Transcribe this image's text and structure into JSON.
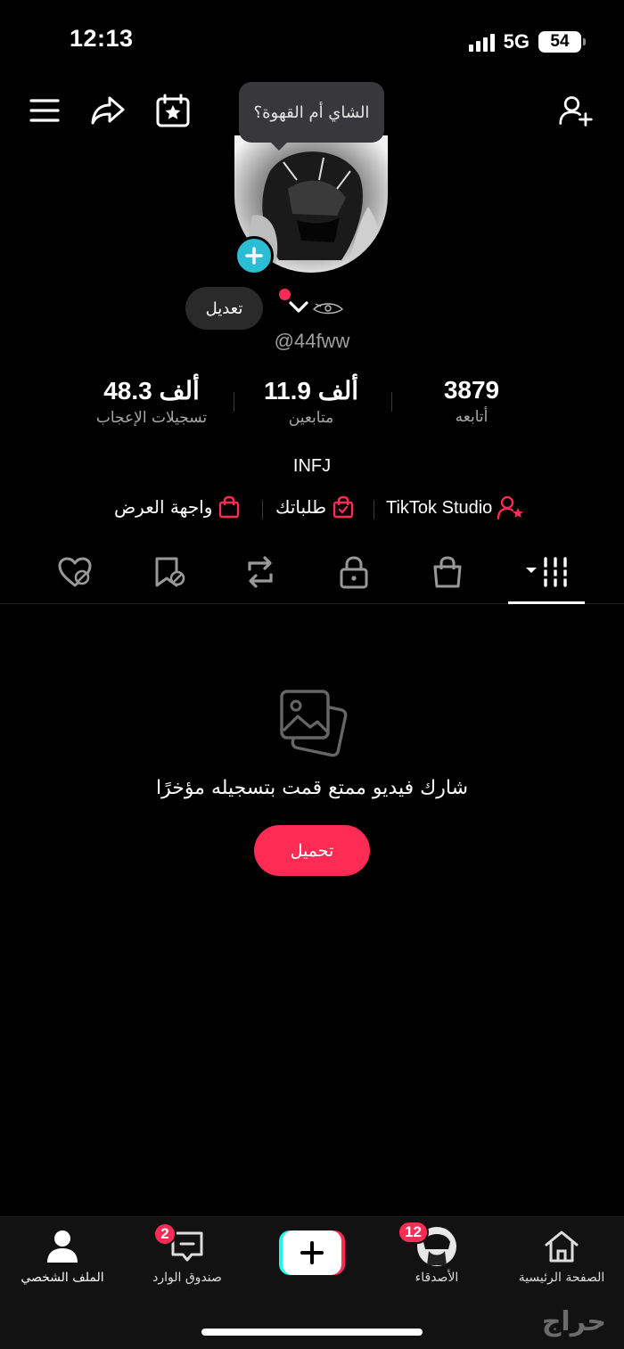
{
  "status_bar": {
    "time": "12:13",
    "network": "5G",
    "battery": "54"
  },
  "tooltip": "الشاي أم القهوة؟",
  "profile": {
    "edit_label": "تعديل",
    "username": "@44fww",
    "bio": "INFJ"
  },
  "stats": [
    {
      "value": "48.3 ألف",
      "label": "تسجيلات الإعجاب"
    },
    {
      "value": "11.9 ألف",
      "label": "متابعين"
    },
    {
      "value": "3879",
      "label": "أتابعه"
    }
  ],
  "links": {
    "studio": "TikTok Studio",
    "orders": "طلباتك",
    "showcase": "واجهة العرض"
  },
  "empty_state": {
    "message": "شارك فيديو ممتع قمت بتسجيله مؤخرًا",
    "upload_label": "تحميل"
  },
  "bottom_nav": {
    "profile": "الملف الشخصي",
    "inbox": "صندوق الوارد",
    "inbox_badge": "2",
    "friends": "الأصدقاء",
    "friends_badge": "12",
    "home": "الصفحة الرئيسية"
  },
  "watermark": "حراج",
  "colors": {
    "accent": "#fe2c55",
    "add_blue": "#2bbdd3",
    "background": "#000000"
  }
}
